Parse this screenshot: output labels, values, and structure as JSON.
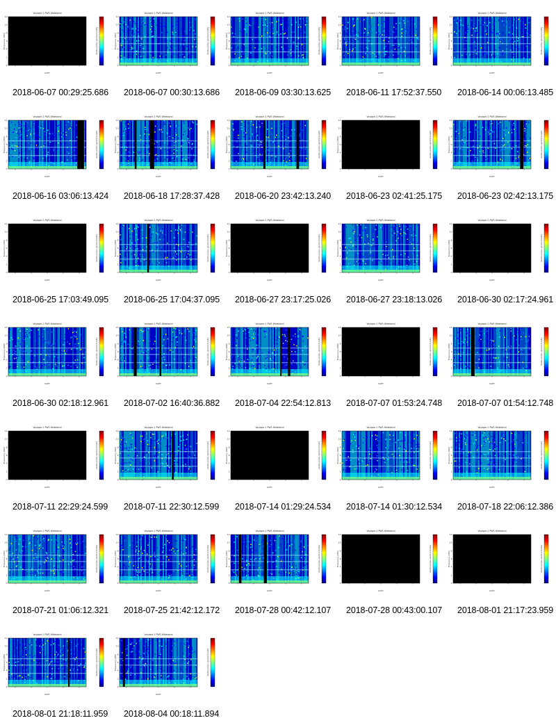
{
  "figure": {
    "panel_title_prefix": "Voyager-1 PWS Wideband",
    "ylabel": "Frequency (kHz)",
    "cbar_label": "relative power spectral density",
    "xlabel_prefix": "SCET",
    "ylim": [
      0,
      12
    ],
    "yticks": [
      "0",
      "2",
      "4",
      "6",
      "8",
      "10",
      "12"
    ],
    "colormap": [
      "#00007f",
      "#0000ff",
      "#0080ff",
      "#00ffff",
      "#80ff80",
      "#ffff00",
      "#ff8000",
      "#ff0000",
      "#7f0000"
    ],
    "empty_color": "#000000"
  },
  "chart_data": {
    "type": "heatmap",
    "panels": [
      {
        "caption": "2018-06-07 00:29:25.686",
        "status": "empty"
      },
      {
        "caption": "2018-06-07 00:30:13.686",
        "status": "data"
      },
      {
        "caption": "2018-06-09 03:30:13.625",
        "status": "data"
      },
      {
        "caption": "2018-06-11 17:52:37.550",
        "status": "data"
      },
      {
        "caption": "2018-06-14 00:06:13.485",
        "status": "data"
      },
      {
        "caption": "2018-06-16 03:06:13.424",
        "status": "data"
      },
      {
        "caption": "2018-06-18 17:28:37.428",
        "status": "data"
      },
      {
        "caption": "2018-06-20 23:42:13.240",
        "status": "data"
      },
      {
        "caption": "2018-06-23 02:41:25.175",
        "status": "empty"
      },
      {
        "caption": "2018-06-23 02:42:13.175",
        "status": "data"
      },
      {
        "caption": "2018-06-25 17:03:49.095",
        "status": "empty"
      },
      {
        "caption": "2018-06-25 17:04:37.095",
        "status": "data"
      },
      {
        "caption": "2018-06-27 23:17:25.026",
        "status": "empty"
      },
      {
        "caption": "2018-06-27 23:18:13.026",
        "status": "data"
      },
      {
        "caption": "2018-06-30 02:17:24.961",
        "status": "empty"
      },
      {
        "caption": "2018-06-30 02:18:12.961",
        "status": "data"
      },
      {
        "caption": "2018-07-02 16:40:36.882",
        "status": "data"
      },
      {
        "caption": "2018-07-04 22:54:12.813",
        "status": "data"
      },
      {
        "caption": "2018-07-07 01:53:24.748",
        "status": "empty"
      },
      {
        "caption": "2018-07-07 01:54:12.748",
        "status": "data"
      },
      {
        "caption": "2018-07-11 22:29:24.599",
        "status": "empty"
      },
      {
        "caption": "2018-07-11 22:30:12.599",
        "status": "data"
      },
      {
        "caption": "2018-07-14 01:29:24.534",
        "status": "empty"
      },
      {
        "caption": "2018-07-14 01:30:12.534",
        "status": "data"
      },
      {
        "caption": "2018-07-18 22:06:12.386",
        "status": "data"
      },
      {
        "caption": "2018-07-21 01:06:12.321",
        "status": "data"
      },
      {
        "caption": "2018-07-25 21:42:12.172",
        "status": "data"
      },
      {
        "caption": "2018-07-28 00:42:12.107",
        "status": "data"
      },
      {
        "caption": "2018-07-28 00:43:00.107",
        "status": "empty"
      },
      {
        "caption": "2018-08-01 21:17:23.959",
        "status": "empty"
      },
      {
        "caption": "2018-08-01 21:18:11.959",
        "status": "data"
      },
      {
        "caption": "2018-08-04 00:18:11.894",
        "status": "data"
      }
    ]
  }
}
